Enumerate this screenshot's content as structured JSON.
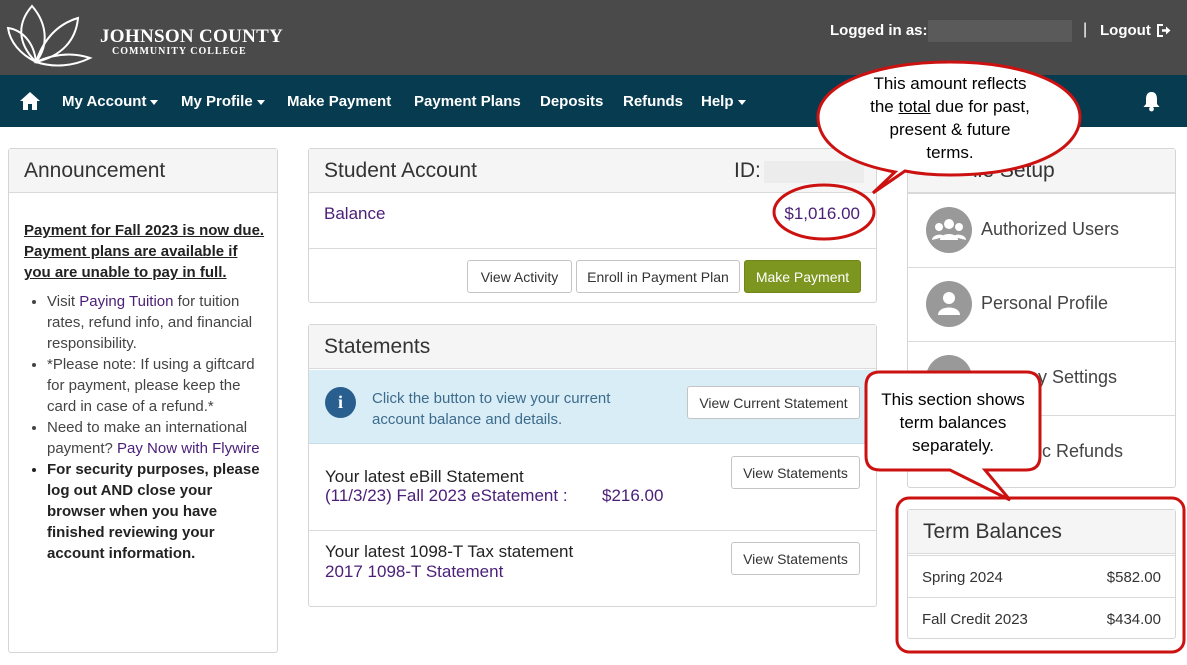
{
  "brand": {
    "name": "Johnson County",
    "sub": "Community College"
  },
  "header": {
    "logged_in_label": "Logged in as:",
    "separator": "|",
    "logout_label": "Logout"
  },
  "nav": {
    "items": [
      "My Account",
      "My Profile",
      "Make Payment",
      "Payment Plans",
      "Deposits",
      "Refunds",
      "Help"
    ]
  },
  "announcement": {
    "title": "Announcement",
    "headline": "Payment for Fall 2023 is now due.  Payment plans are available if you are unable to pay in full.",
    "bullet1_pre": "Visit ",
    "bullet1_link": "Paying Tuition",
    "bullet1_post": " for tuition rates, refund info, and financial responsibility.",
    "bullet2": "*Please note: If using a giftcard for payment, please keep the card in case of a refund.*",
    "bullet3_pre": "Need to make an international payment? ",
    "bullet3_link": "Pay Now with Flywire",
    "bullet4": "For security purposes, please log out AND close your browser when you have finished reviewing your account information."
  },
  "student_account": {
    "title": "Student Account",
    "id_label": "ID:",
    "balance_label": "Balance",
    "balance_value": "$1,016.00",
    "buttons": {
      "view_activity": "View Activity",
      "enroll": "Enroll in Payment Plan",
      "make_payment": "Make Payment"
    }
  },
  "statements": {
    "title": "Statements",
    "info_text": "Click the button to view your current account balance and details.",
    "view_current_btn": "View Current Statement",
    "ebill_title": "Your latest eBill Statement",
    "ebill_link": "(11/3/23) Fall 2023 eStatement :",
    "ebill_amount": "$216.00",
    "view_statements_btn": "View Statements",
    "tax_title": "Your latest 1098-T Tax statement",
    "tax_link": "2017 1098-T Statement"
  },
  "profile_setup": {
    "title_visible": "ile Setup",
    "items": [
      "Authorized Users",
      "Personal Profile",
      "y Settings",
      "ic Refunds"
    ]
  },
  "term_balances": {
    "title": "Term Balances",
    "rows": [
      {
        "name": "Spring 2024",
        "amount": "$582.00"
      },
      {
        "name": "Fall Credit 2023",
        "amount": "$434.00"
      }
    ]
  },
  "callouts": {
    "total": {
      "line1": "This amount reflects",
      "line2_pre": "the ",
      "line2_u": "total",
      "line2_post": " due for past,",
      "line3": "present & future",
      "line4": "terms."
    },
    "term": {
      "line1": "This section shows",
      "line2": "term balances",
      "line3": "separately."
    }
  },
  "colors": {
    "header_bg": "#4a4a4a",
    "nav_bg": "#073c50",
    "link": "#4a1f78",
    "green": "#7c9620",
    "annotation_red": "#cc1111",
    "info_bg": "#d9edf7"
  }
}
